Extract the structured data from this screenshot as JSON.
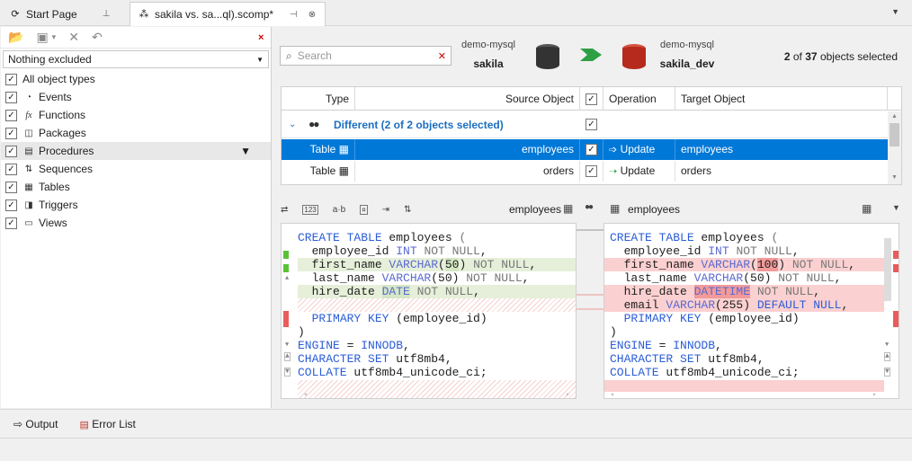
{
  "tabs": [
    {
      "label": "Start Page"
    },
    {
      "label": "sakila vs. sa...ql).scomp*"
    }
  ],
  "left": {
    "dropdown": "Nothing excluded",
    "items": [
      {
        "label": "All object types",
        "icon": "stack-icon"
      },
      {
        "label": "Events",
        "icon": "clock-icon"
      },
      {
        "label": "Functions",
        "icon": "function-icon"
      },
      {
        "label": "Packages",
        "icon": "package-icon"
      },
      {
        "label": "Procedures",
        "icon": "procedure-icon"
      },
      {
        "label": "Sequences",
        "icon": "sequence-icon"
      },
      {
        "label": "Tables",
        "icon": "table-icon"
      },
      {
        "label": "Triggers",
        "icon": "trigger-icon"
      },
      {
        "label": "Views",
        "icon": "view-icon"
      }
    ]
  },
  "header": {
    "search_placeholder": "Search",
    "source_server": "demo-mysql",
    "source_db": "sakila",
    "target_server": "demo-mysql",
    "target_db": "sakila_dev",
    "sel_count": "2",
    "sel_total": "37",
    "sel_of": "of",
    "sel_suffix": "objects selected",
    "source_color": "#3a3a3a",
    "target_color": "#c0392b",
    "arrow_color": "#2ea043"
  },
  "grid": {
    "columns": {
      "type": "Type",
      "source": "Source Object",
      "operation": "Operation",
      "target": "Target Object"
    },
    "group": "Different (2 of 2 objects selected)",
    "rows": [
      {
        "type": "Table",
        "source": "employees",
        "operation": "Update",
        "target": "employees"
      },
      {
        "type": "Table",
        "source": "orders",
        "operation": "Update",
        "target": "orders"
      }
    ]
  },
  "compare": {
    "source_title": "employees",
    "target_title": "employees",
    "source_lines": [
      "CREATE TABLE employees (",
      "  employee_id INT NOT NULL,",
      "  first_name VARCHAR(50) NOT NULL,",
      "  last_name VARCHAR(50) NOT NULL,",
      "  hire_date DATE NOT NULL,",
      "",
      "  PRIMARY KEY (employee_id)",
      ")",
      "ENGINE = INNODB,",
      "CHARACTER SET utf8mb4,",
      "COLLATE utf8mb4_unicode_ci;"
    ],
    "target_lines": [
      "CREATE TABLE employees (",
      "  employee_id INT NOT NULL,",
      "  first_name VARCHAR(100) NOT NULL,",
      "  last_name VARCHAR(50) NOT NULL,",
      "  hire_date DATETIME NOT NULL,",
      "  email VARCHAR(255) DEFAULT NULL,",
      "  PRIMARY KEY (employee_id)",
      ")",
      "ENGINE = INNODB,",
      "CHARACTER SET utf8mb4,",
      "COLLATE utf8mb4_unicode_ci;"
    ]
  },
  "bottom": {
    "output": "Output",
    "errors": "Error List"
  }
}
